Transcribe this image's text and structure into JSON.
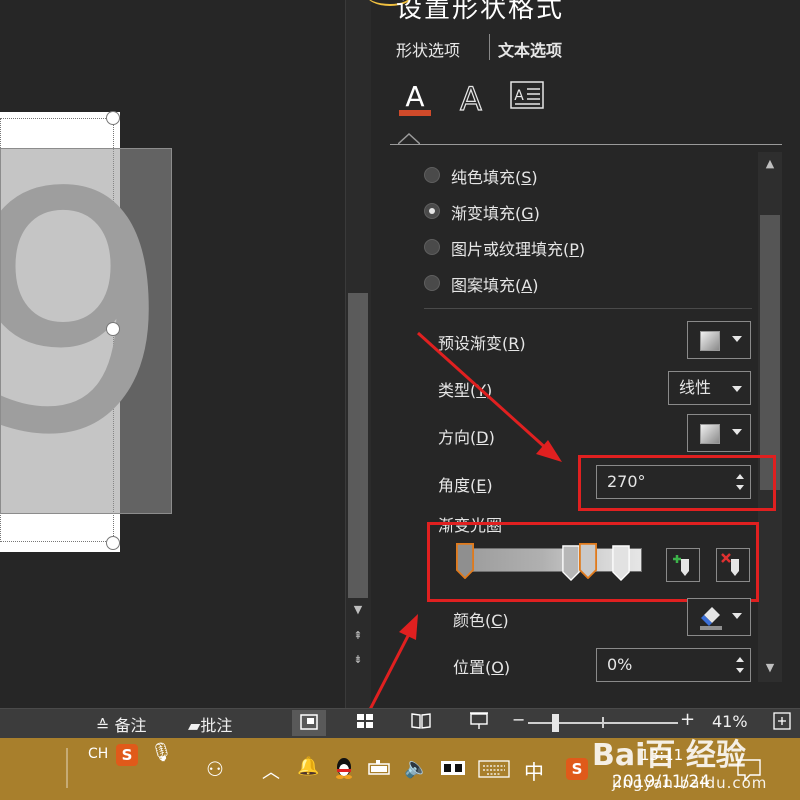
{
  "pane": {
    "title": "设置形状格式",
    "tabs": [
      "形状选项",
      "文本选项"
    ],
    "icon_tabs": [
      "text-fill-outline-icon",
      "text-effects-icon",
      "textbox-icon"
    ],
    "fill_options": [
      {
        "text": "纯色填充(",
        "key": "S",
        "selected": false
      },
      {
        "text": "渐变填充(",
        "key": "G",
        "selected": true
      },
      {
        "text": "图片或纹理填充(",
        "key": "P",
        "selected": false
      },
      {
        "text": "图案填充(",
        "key": "A",
        "selected": false
      }
    ],
    "preset_gradient": {
      "text": "预设渐变(",
      "key": "R"
    },
    "type": {
      "text": "类型(",
      "key": "Y",
      "value": "线性"
    },
    "direction": {
      "text": "方向(",
      "key": "D"
    },
    "angle": {
      "text": "角度(",
      "key": "E",
      "value": "270°"
    },
    "gradient_stops_label": "渐变光圈",
    "color": {
      "text": "颜色(",
      "key": "C"
    },
    "position": {
      "text": "位置(",
      "key": "O",
      "value": "0%"
    }
  },
  "slide": {
    "big_text": "9"
  },
  "statusbar": {
    "notes": "备注",
    "comments": "批注",
    "zoom": "41%",
    "zoom_level": 0.18
  },
  "taskbar": {
    "lang": "CH",
    "ime": "中",
    "time": "13:11",
    "date": "2019/11/24"
  },
  "watermark": {
    "logo": "Bai百 经验",
    "sub": "jingyan.baidu.com"
  },
  "colors": {
    "annotation_red": "#e02020",
    "taskbar": "#a87f2c",
    "stop_selected": "#e07a1c"
  }
}
